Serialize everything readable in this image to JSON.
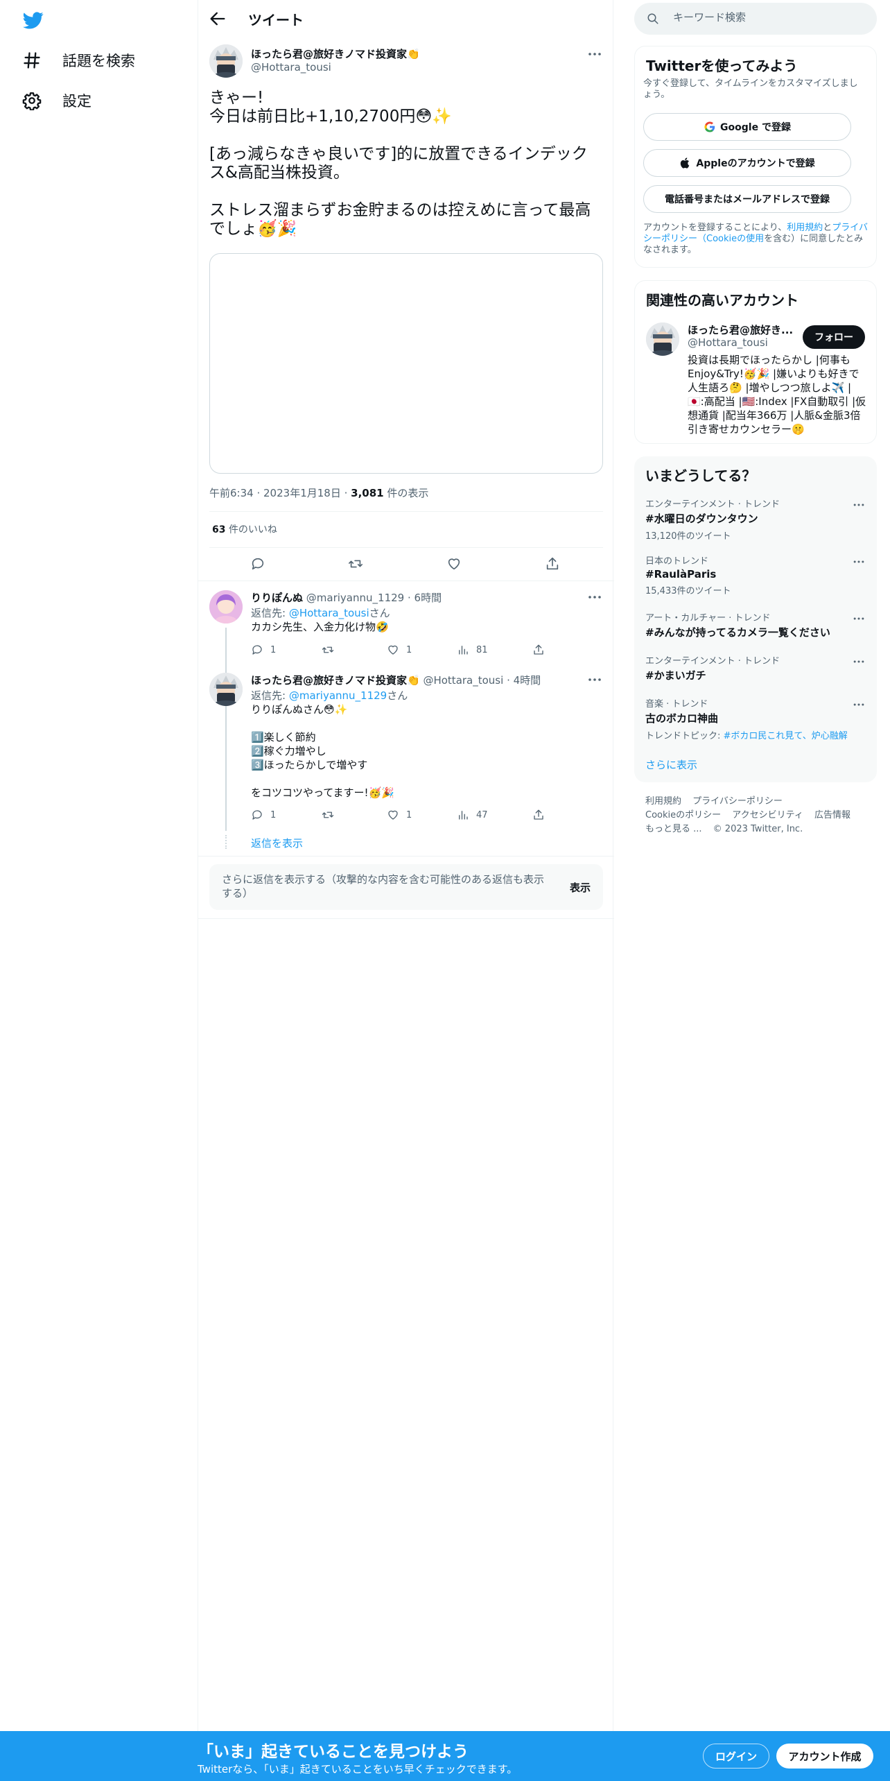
{
  "nav": {
    "explore_label": "話題を検索",
    "settings_label": "設定"
  },
  "header": {
    "title": "ツイート"
  },
  "tweet": {
    "author_name": "ほったら君@旅好きノマド投資家👏",
    "handle": "@Hottara_tousi",
    "text": "きゃー!\n今日は前日比+1,10,2700円😳✨\n\n[あっ減らなきゃ良いです]的に放置できるインデックス&高配当株投資。\n\nストレス溜まらずお金貯まるのは控えめに言って最高でしょ🥳🎉",
    "time": "午前6:34",
    "date": "2023年1月18日",
    "views_count": "3,081",
    "views_label": "件の表示",
    "likes_count": "63",
    "likes_label": "件のいいね"
  },
  "replies": [
    {
      "name": "りりぽんぬ",
      "handle": "@mariyannu_1129",
      "time": "6時間",
      "replying_prefix": "返信先: ",
      "replying_to": "@Hottara_tousi",
      "replying_suffix": "さん",
      "text": "カカシ先生、入金力化け物🤣",
      "reply_count": "1",
      "like_count": "1",
      "view_count": "81"
    },
    {
      "name": "ほったら君@旅好きノマド投資家👏",
      "handle": "@Hottara_tousi",
      "time": "4時間",
      "replying_prefix": "返信先: ",
      "replying_to": "@mariyannu_1129",
      "replying_suffix": "さん",
      "text": "りりぽんぬさん😳✨\n\n1️⃣楽しく節約\n2️⃣稼ぐ力増やし\n3️⃣ほったらかしで増やす\n\nをコツコツやってますー!🥳🎉",
      "reply_count": "1",
      "like_count": "1",
      "view_count": "47"
    }
  ],
  "show_thread_label": "返信を表示",
  "show_more_replies": {
    "text": "さらに返信を表示する（攻撃的な内容を含む可能性のある返信も表示する）",
    "button": "表示"
  },
  "search": {
    "placeholder": "キーワード検索"
  },
  "signup_card": {
    "title": "Twitterを使ってみよう",
    "subtitle": "今すぐ登録して、タイムラインをカスタマイズしましょう。",
    "google_label": "Google で登録",
    "apple_label": "Appleのアカウントで登録",
    "phone_label": "電話番号またはメールアドレスで登録",
    "legal_prefix": "アカウントを登録することにより、",
    "legal_terms": "利用規約",
    "legal_and": "と",
    "legal_privacy": "プライバシーポリシー（Cookieの使用",
    "legal_suffix": "を含む）に同意したとみなされます。"
  },
  "related": {
    "title": "関連性の高いアカウント",
    "name": "ほったら君@旅好き...",
    "handle": "@Hottara_tousi",
    "follow_label": "フォロー",
    "bio": "投資は長期でほったらかし |何事もEnjoy&Try!🥳🎉 |嫌いよりも好きで人生語ろ🤔 |増やしつつ旅しよ✈️ |🇯🇵:高配当 |🇺🇸:Index |FX自動取引 |仮想通貨 |配当年366万 |人脈&金脈3倍引き寄せカウンセラー🤫"
  },
  "trends": {
    "title": "いまどうしてる？",
    "items": [
      {
        "category": "エンターテインメント · トレンド",
        "name": "#水曜日のダウンタウン",
        "count": "13,120件のツイート"
      },
      {
        "category": "日本のトレンド",
        "name": "#RaulàParis",
        "count": "15,433件のツイート"
      },
      {
        "category": "アート・カルチャー · トレンド",
        "name": "#みんなが持ってるカメラ一覧ください",
        "count": ""
      },
      {
        "category": "エンターテインメント · トレンド",
        "name": "#かまいガチ",
        "count": ""
      },
      {
        "category": "音楽 · トレンド",
        "name": "古のボカロ神曲",
        "count": "",
        "topic_prefix": "トレンドトピック: ",
        "topic": "#ボカロ民これ見て、炉心融解"
      }
    ],
    "show_more": "さらに表示"
  },
  "footer": {
    "links": [
      "利用規約",
      "プライバシーポリシー",
      "Cookieのポリシー",
      "アクセシビリティ",
      "広告情報",
      "もっと見る ..."
    ],
    "copyright": "© 2023 Twitter, Inc."
  },
  "bottom_bar": {
    "title": "「いま」起きていることを見つけよう",
    "subtitle": "Twitterなら、「いま」起きていることをいち早くチェックできます。",
    "login_label": "ログイン",
    "signup_label": "アカウント作成"
  },
  "colors": {
    "accent": "#1d9bf0",
    "text_primary": "#0f1419",
    "text_secondary": "#536471",
    "border": "#eff3f4"
  },
  "icons": {
    "logo": "twitter-bird-icon",
    "explore": "hash-icon",
    "settings": "gear-icon",
    "back": "arrow-left-icon",
    "more": "more-dots-icon",
    "reply": "reply-icon",
    "retweet": "retweet-icon",
    "like": "heart-icon",
    "share": "share-icon",
    "views": "bar-chart-icon",
    "search": "search-icon"
  }
}
